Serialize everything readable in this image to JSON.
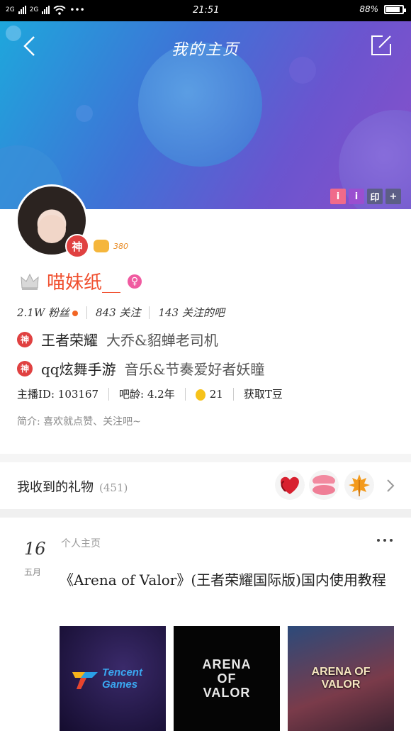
{
  "status_bar": {
    "signal_1": "2G",
    "signal_2": "2G",
    "more": "•••",
    "time": "21:51",
    "battery": "88%",
    "battery_fraction": 0.88
  },
  "nav": {
    "title": "我的主页"
  },
  "header_badges": [
    "i",
    "i",
    "印",
    "+"
  ],
  "profile": {
    "avatar_badge": "神",
    "level": "380",
    "name": "喵妹纸__",
    "gender_symbol": "♀",
    "stats": {
      "fans": "2.1W 粉丝",
      "following": "843 关注",
      "bars": "143 关注的吧"
    },
    "tags": [
      {
        "badge": "神",
        "main": "王者荣耀",
        "sub": "大乔&貂蝉老司机"
      },
      {
        "badge": "神",
        "main": "qq炫舞手游",
        "sub": "音乐&节奏爱好者妖瞳"
      }
    ],
    "meta": {
      "anchor_id": "主播ID: 103167",
      "bar_age": "吧龄: 4.2年",
      "coins": "21",
      "get_coins": "获取T豆"
    },
    "intro": "简介: 喜欢就点赞、关注吧~"
  },
  "gifts": {
    "label": "我收到的礼物",
    "count": "(451)"
  },
  "post": {
    "day": "16",
    "month": "五月",
    "source": "个人主页",
    "title": "《Arena of Valor》(王者荣耀国际版)国内使用教程",
    "thumbs": [
      "Tencent Games",
      "ARENA OF VALOR",
      "ARENA OF VALOR"
    ]
  },
  "colors": {
    "accent": "#f04f2e",
    "badge_red": "#e04141",
    "gender_pink": "#f05aa0"
  }
}
